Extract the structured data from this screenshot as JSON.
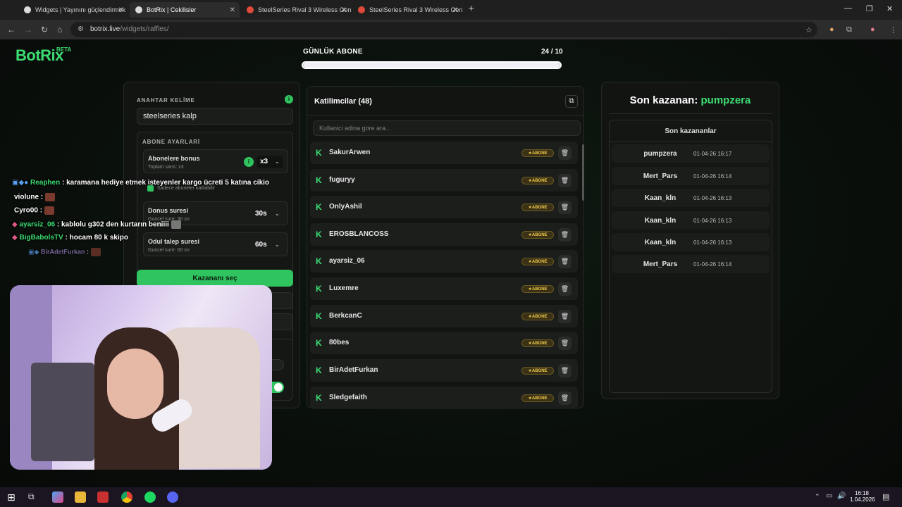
{
  "tabs": [
    {
      "title": "Widgets | Yayınını güçlendirmek"
    },
    {
      "title": "BotRix | Cekilisler"
    },
    {
      "title": "SteelSeries Rival 3 Wireless Gen"
    },
    {
      "title": "SteelSeries Rival 3 Wireless Gen"
    }
  ],
  "address": {
    "domain": "botrix.live",
    "path": "/widgets/raffles/"
  },
  "logo": {
    "text": "BotRix",
    "beta": "BETA"
  },
  "goal": {
    "title": "GÜNLÜK ABONE",
    "count": "24 / 10",
    "progress": 1.0
  },
  "settings": {
    "keyword_label": "ANAHTAR KELİME",
    "keyword_value": "steelseries kalp",
    "sub_settings_label": "ABONE AYARLARİ",
    "sub_bonus_title": "Abonelere bonus",
    "sub_bonus_sub": "Toplam sans: x3",
    "sub_bonus_value": "x3",
    "only_subs": "Sadece aboneler katilabilir",
    "donus_title": "Donus suresi",
    "donus_sub": "Guncel sure: 30 sn",
    "donus_value": "30s",
    "odul_title": "Odul talep suresi",
    "odul_sub": "Guncel sure: 60 sn",
    "odul_value": "60s",
    "pick_button": "Kazananı seç"
  },
  "participants": {
    "title": "Katilimcilar (48)",
    "search_placeholder": "Kullanici adina gore ara...",
    "badge": "ABONE",
    "items": [
      "SakurArwen",
      "fuguryy",
      "OnlyAshil",
      "EROSBLANCOSS",
      "ayarsiz_06",
      "Luxemre",
      "BerkcanC",
      "80bes",
      "BirAdetFurkan",
      "Sledgefaith"
    ]
  },
  "winners": {
    "last_label": "Son kazanan:",
    "last_name": "pumpzera",
    "list_title": "Son kazananlar",
    "items": [
      {
        "name": "pumpzera",
        "date": "01-04-26 16:17"
      },
      {
        "name": "Mert_Pars",
        "date": "01-04-26 16:14"
      },
      {
        "name": "Kaan_kln",
        "date": "01-04-26 16:13"
      },
      {
        "name": "Kaan_kln",
        "date": "01-04-26 16:13"
      },
      {
        "name": "Kaan_kln",
        "date": "01-04-26 16:13"
      },
      {
        "name": "Mert_Pars",
        "date": "01-04-26 16:14"
      }
    ]
  },
  "chat": [
    {
      "user": "Reaphen",
      "color": "#3ddc73",
      "msg": ": karamana hediye etmek isteyenler kargo ücreti 5 katına cikio"
    },
    {
      "user": "violune",
      "color": "#ffffff",
      "msg": ":"
    },
    {
      "user": "Cyro00",
      "color": "#ffffff",
      "msg": ":"
    },
    {
      "user": "ayarsiz_06",
      "color": "#3ddc73",
      "msg": ": kablolu g302 den kurtarın beniiii"
    },
    {
      "user": "BigBabolsTV",
      "color": "#3ddc73",
      "msg": ": hocam 80 k skipo"
    },
    {
      "user": "BirAdetFurkan",
      "color": "#a28ad6",
      "msg": ":"
    }
  ],
  "clock": {
    "time": "16:18",
    "date": "1.04.2026"
  }
}
